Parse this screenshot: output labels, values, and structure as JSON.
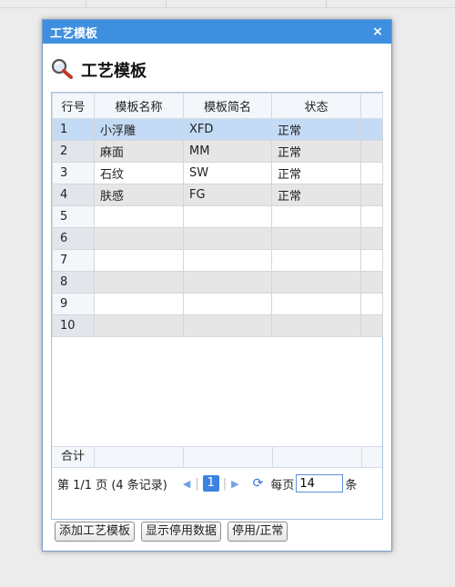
{
  "dialog": {
    "title": "工艺模板",
    "close_glyph": "×"
  },
  "header": {
    "title": "工艺模板",
    "icon": "search-magnifier-icon"
  },
  "grid": {
    "columns": [
      "行号",
      "模板名称",
      "模板简名",
      "状态"
    ],
    "rows": [
      {
        "num": "1",
        "name": "小浮雕",
        "short": "XFD",
        "status": "正常"
      },
      {
        "num": "2",
        "name": "麻面",
        "short": "MM",
        "status": "正常"
      },
      {
        "num": "3",
        "name": "石纹",
        "short": "SW",
        "status": "正常"
      },
      {
        "num": "4",
        "name": "肤感",
        "short": "FG",
        "status": "正常"
      },
      {
        "num": "5",
        "name": "",
        "short": "",
        "status": ""
      },
      {
        "num": "6",
        "name": "",
        "short": "",
        "status": ""
      },
      {
        "num": "7",
        "name": "",
        "short": "",
        "status": ""
      },
      {
        "num": "8",
        "name": "",
        "short": "",
        "status": ""
      },
      {
        "num": "9",
        "name": "",
        "short": "",
        "status": ""
      },
      {
        "num": "10",
        "name": "",
        "short": "",
        "status": ""
      }
    ],
    "total_label": "合计"
  },
  "pager": {
    "page_info": "第  1/1 页  (4 条记录)",
    "current_page": "1",
    "per_page_label": "每页",
    "per_page_value": "14",
    "per_page_unit": "条"
  },
  "buttons": {
    "add": "添加工艺模板",
    "show_disabled": "显示停用数据",
    "toggle": "停用/正常"
  },
  "colors": {
    "titlebar": "#3f8fe0",
    "selected_row": "#c4dbf5",
    "accent": "#3c82e0"
  }
}
